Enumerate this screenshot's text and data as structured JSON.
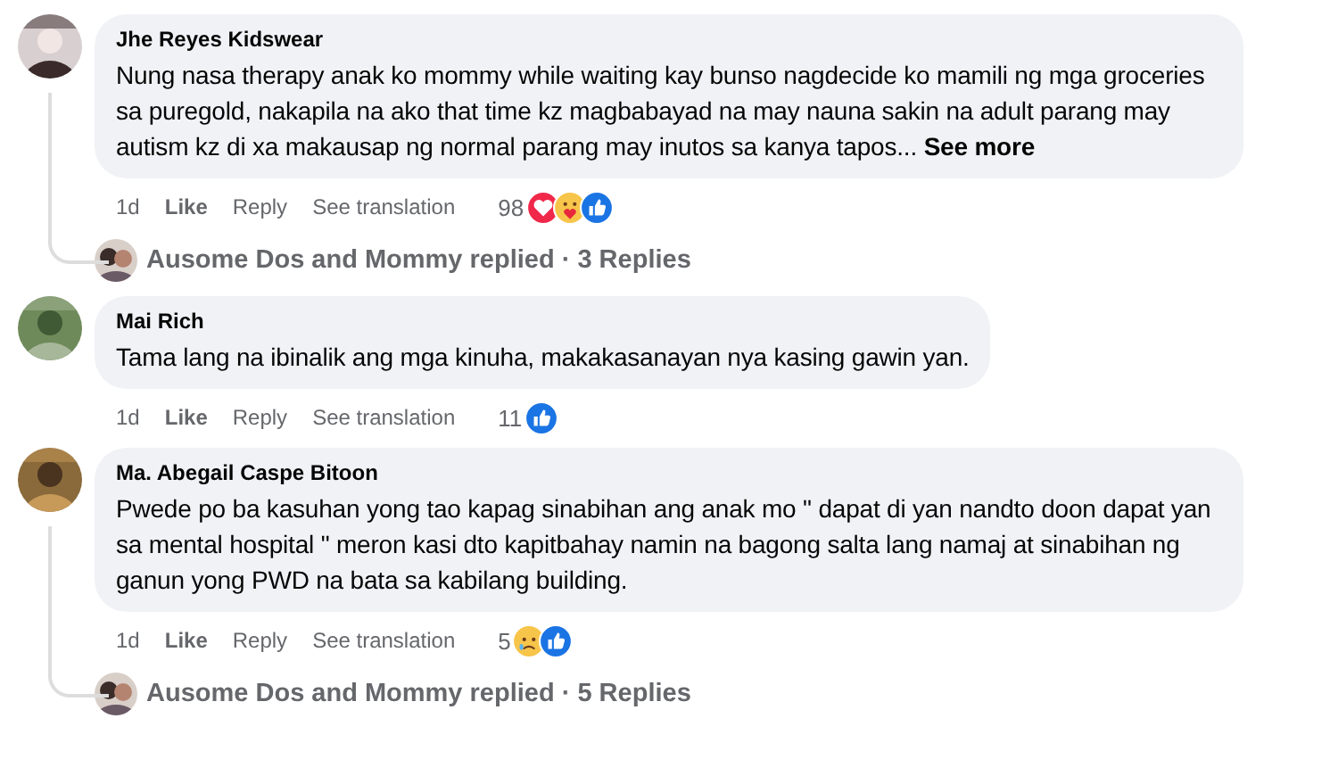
{
  "comments": [
    {
      "author": "Jhe Reyes Kidswear",
      "text": "Nung nasa therapy anak ko mommy while waiting kay bunso nagdecide ko mamili ng mga groceries sa puregold, nakapila na ako that time kz magbabayad na may nauna sakin na adult parang may autism kz di xa makausap ng normal parang may inutos sa kanya tapos... **See more**",
      "time": "1d",
      "actions": [
        "Like",
        "Reply",
        "See translation"
      ],
      "reaction_count": "98",
      "reactions": [
        {
          "kind": "love"
        },
        {
          "kind": "care"
        },
        {
          "kind": "like"
        }
      ],
      "replies": {
        "text": "Ausome Dos and Mommy replied · 3 Replies"
      }
    },
    {
      "author": "Mai Rich",
      "text": "Tama lang na ibinalik ang mga kinuha, makakasanayan nya kasing gawin yan.",
      "time": "1d",
      "actions": [
        "Like",
        "Reply",
        "See translation"
      ],
      "reaction_count": "11",
      "reactions": [
        {
          "kind": "like"
        }
      ]
    },
    {
      "author": "Ma. Abegail Caspe Bitoon",
      "text": "Pwede po ba kasuhan yong tao kapag sinabihan ang anak mo \" dapat di yan nandto doon dapat yan sa mental hospital \" meron kasi dto kapitbahay namin na bagong salta lang namaj at sinabihan ng ganun yong PWD na bata sa kabilang building.",
      "time": "1d",
      "actions": [
        "Like",
        "Reply",
        "See translation"
      ],
      "reaction_count": "5",
      "reactions": [
        {
          "kind": "sad"
        },
        {
          "kind": "like"
        }
      ],
      "replies": {
        "text": "Ausome Dos and Mommy replied · 5 Replies"
      }
    }
  ]
}
